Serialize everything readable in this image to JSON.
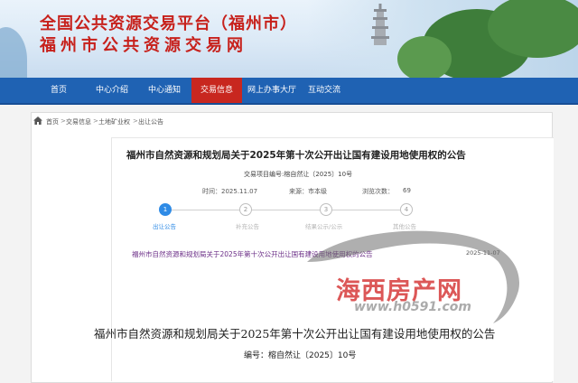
{
  "header": {
    "title_line1": "全国公共资源交易平台（福州市）",
    "title_line2": "福州市公共资源交易网"
  },
  "nav": {
    "items": [
      {
        "label": "首页",
        "active": false
      },
      {
        "label": "中心介绍",
        "active": false
      },
      {
        "label": "中心通知",
        "active": false
      },
      {
        "label": "交易信息",
        "active": true
      },
      {
        "label": "网上办事大厅",
        "active": false
      },
      {
        "label": "互动交流",
        "active": false
      }
    ]
  },
  "breadcrumb": {
    "items": [
      "首页",
      "交易信息",
      "土地矿业权",
      "出让公告"
    ],
    "separator": ">"
  },
  "announcement": {
    "title": "福州市自然资源和规划局关于2025年第十次公开出让国有建设用地使用权的公告",
    "code": "交易项目编号:榕自然让〔2025〕10号",
    "time_label": "时间：2025.11.07",
    "source_label": "来源：市本级",
    "views_label": "浏览次数：",
    "views": "69"
  },
  "steps": [
    {
      "num": "1",
      "label": "出让公告",
      "active": true
    },
    {
      "num": "2",
      "label": "补充公告",
      "active": false
    },
    {
      "num": "3",
      "label": "结果公示/公示",
      "active": false
    },
    {
      "num": "4",
      "label": "其他公告",
      "active": false
    }
  ],
  "doc_list": {
    "link": "福州市自然资源和规划局关于2025年第十次公开出让国有建设用地使用权的公告",
    "date": "2025-11-07"
  },
  "body": {
    "title": "福州市自然资源和规划局关于2025年第十次公开出让国有建设用地使用权的公告",
    "code": "编号：榕自然让〔2025〕10号"
  },
  "watermark": {
    "brand": "海西房产网",
    "url": "www.h0591.com"
  },
  "colors": {
    "brand_red": "#c7211c",
    "nav_blue": "#1f62b3",
    "nav_active": "#c8271f",
    "step_active": "#2f8be6",
    "link_purple": "#6a2c86"
  }
}
